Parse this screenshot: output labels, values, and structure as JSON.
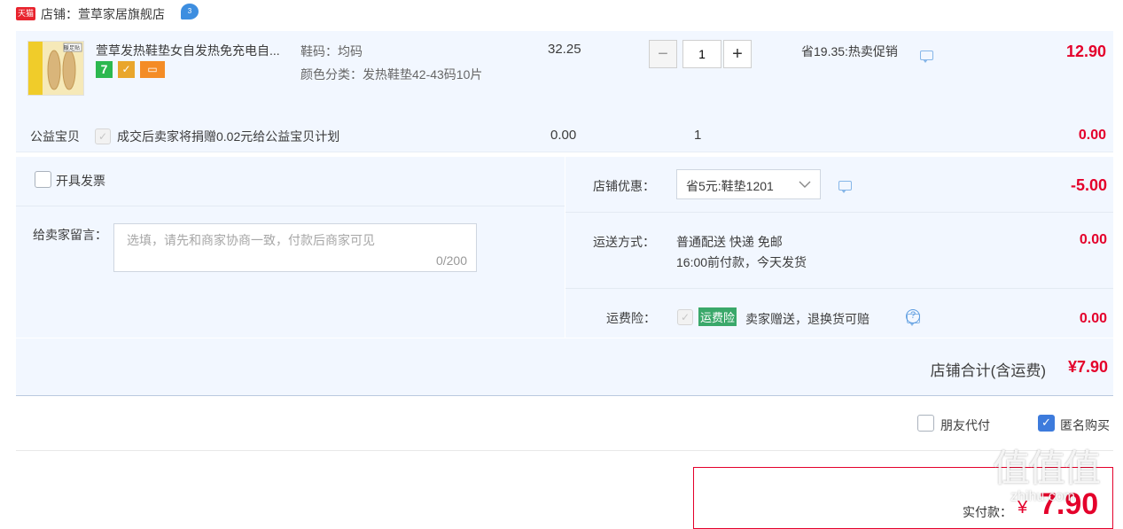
{
  "shop": {
    "badge": "天猫",
    "label": "店铺：",
    "name": "萱草家居旗舰店",
    "wangwang_badge": "3"
  },
  "item": {
    "thumb_text": "暖足贴",
    "title": "萱草发热鞋垫女自发热免充电自...",
    "spec_size": "鞋码：均码",
    "spec_color": "颜色分类：发热鞋垫42-43码10片",
    "unit_price": "32.25",
    "quantity": "1",
    "minus_label": "−",
    "plus_label": "+",
    "promo": "省19.35:热卖促销",
    "subtotal": "12.90",
    "badges": [
      {
        "text": "7",
        "color": "#2cb84f"
      },
      {
        "text": "✓",
        "color": "#e9a62c"
      },
      {
        "text": "▭",
        "color": "#f48c26"
      }
    ]
  },
  "charity": {
    "label": "公益宝贝",
    "text": "成交后卖家将捐赠0.02元给公益宝贝计划",
    "price": "0.00",
    "quantity": "1",
    "total": "0.00"
  },
  "invoice": {
    "label": "开具发票"
  },
  "message": {
    "label": "给卖家留言：",
    "placeholder": "选填，请先和商家协商一致，付款后商家可见",
    "counter": "0/200"
  },
  "shop_discount": {
    "label": "店铺优惠：",
    "selected": "省5元:鞋垫1201",
    "amount": "-5.00"
  },
  "shipping": {
    "label": "运送方式：",
    "method": "普通配送 快递 免邮",
    "note": "16:00前付款，今天发货",
    "amount": "0.00"
  },
  "insurance": {
    "label": "运费险：",
    "tag": "运费险",
    "text": "卖家赠送，退换货可赔",
    "amount": "0.00"
  },
  "total": {
    "label": "店铺合计(含运费)",
    "amount": "¥7.90"
  },
  "options": {
    "friend_pay": "朋友代付",
    "anonymous": "匿名购买"
  },
  "payment": {
    "label": "实付款：",
    "currency": "¥",
    "amount": "7.90"
  },
  "watermark": {
    "big": "值值值",
    "small": "zhihu.com"
  },
  "colors": {
    "price_red": "#e4002b",
    "panel_bg": "#f2f7ff",
    "checkbox_blue": "#3d7bdc",
    "insurance_green": "#3aa86a"
  }
}
